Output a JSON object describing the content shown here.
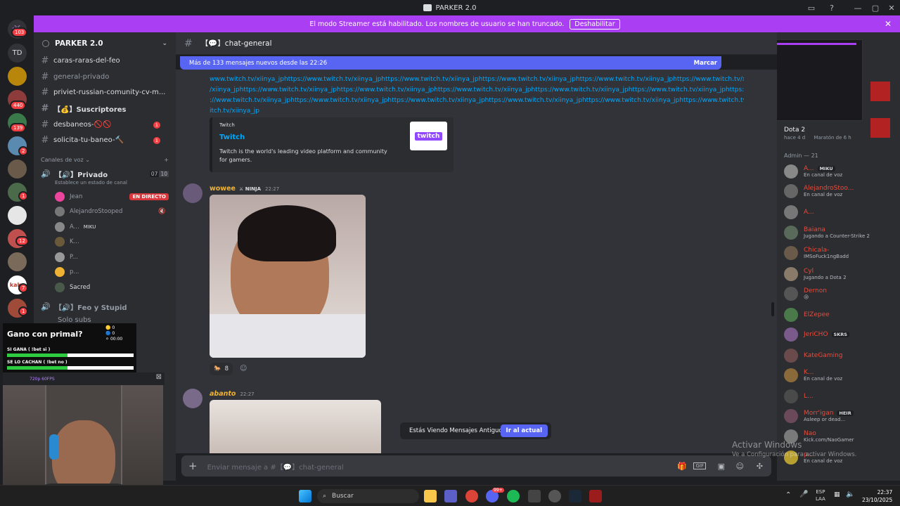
{
  "window": {
    "title": "PARKER 2.0"
  },
  "streamer_banner": {
    "text": "El modo Streamer está habilitado. Los nombres de usuario se han truncado.",
    "button": "Deshabilitar"
  },
  "servers": {
    "top_badge": "103",
    "td_label": "TD",
    "badges": [
      "440",
      "139",
      "2",
      "1",
      "12",
      "7",
      "1"
    ]
  },
  "server": {
    "name": "PARKER 2.0"
  },
  "channels": {
    "text": [
      {
        "name": "caras-raras-del-feo"
      },
      {
        "name": "general-privado"
      },
      {
        "name": "priviet-russian-comunity-cv-m..."
      },
      {
        "name": "【💰】Suscriptores"
      },
      {
        "name": "desbaneos-🚫🚫",
        "badge": "1"
      },
      {
        "name": "solicita-tu-baneo-🔨",
        "badge": "1"
      }
    ],
    "voice_header": "Canales de voz",
    "voice_channel": {
      "name": "【🔊】Privado",
      "count_a": "07",
      "count_b": "10",
      "status": "Establece un estado de canal"
    },
    "voice_users": [
      {
        "name": "Jean",
        "tag": "EN DIRECTO"
      },
      {
        "name": "AlejandroStooped",
        "tag": ""
      },
      {
        "name": "A...",
        "tag": "MIKU"
      },
      {
        "name": "K...",
        "tag": ""
      },
      {
        "name": "P...",
        "tag": ""
      },
      {
        "name": "p...",
        "tag": ""
      },
      {
        "name": "Sacred",
        "tag": ""
      }
    ],
    "voice_channel2": "【🔊】Feo y Stupid",
    "voice_channel3": "Solo subs"
  },
  "overlay": {
    "question": "Gano con primal?",
    "opt1": "SI GANA ( !bet si )",
    "opt2": "SE LO CACHAN ( !bet no )",
    "n1": "0",
    "n2": "0",
    "timer": "00:00",
    "stream_info": "720p 60FPS"
  },
  "chat": {
    "channel_name": "【💬】chat-general",
    "new_messages": "Más de 133 mensajes nuevos desde las 22:26",
    "mark_read": "Marcar",
    "link_lines": [
      "www.twitch.tv/xiinya_jphttps://www.twitch.tv/xiinya_jphttps://www.twitch.tv/xiinya_jphttps://www.twitch.tv/xiinya_jphttps://www.twitch.tv/xiinya_jphttps://www.twitch.tv/xiinya_jphttps://www.twitch.tv/",
      "/xiinya_jphttps://www.twitch.tv/xiinya_jphttps://www.twitch.tv/xiinya_jphttps://www.twitch.tv/xiinya_jphttps://www.twitch.tv/xiinya_jphttps://www.twitch.tv/xiinya_jphttps://www.twitch.tv/xiinya_",
      "://www.twitch.tv/xiinya_jphttps://www.twitch.tv/xiinya_jphttps://www.twitch.tv/xiinya_jphttps://www.twitch.tv/xiinya_jphttps://www.twitch.tv/xiinya_jphttps://www.twitch.tv/xiinya_jphttps://www.twitch.tv/",
      "itch.tv/xiinya_jp"
    ],
    "embed": {
      "provider": "Twitch",
      "title": "Twitch",
      "description": "Twitch is the world's leading video platform and community for gamers."
    },
    "msg1": {
      "author": "wowee",
      "role": "NINJA",
      "time": "22:27",
      "reaction_count": "8"
    },
    "msg2": {
      "author": "abanto",
      "time": "22:27"
    },
    "old_messages": "Estás Viendo Mensajes Antiguos",
    "jump": "Ir al actual",
    "composer_placeholder": "Enviar mensaje a #【💬】chat-general"
  },
  "members": {
    "game": "Dota 2",
    "game_time": "hace 4 d",
    "game_stream": "Maratón de 6 h",
    "section": "Admin — 21",
    "list": [
      {
        "name": "A...",
        "tag": "MIKU",
        "status": "En canal de voz",
        "color": "#e74c3c"
      },
      {
        "name": "AlejandroStoo...",
        "tag": "",
        "status": "En canal de voz",
        "color": "#e74c3c"
      },
      {
        "name": "A...",
        "tag": "",
        "status": "",
        "color": "#e74c3c"
      },
      {
        "name": "Baiana",
        "tag": "",
        "status": "Jugando a Counter-Strike 2",
        "color": "#e74c3c"
      },
      {
        "name": "Chicala-",
        "tag": "",
        "status": "IMSoFuck1ngBadd",
        "color": "#e74c3c"
      },
      {
        "name": "Cyl",
        "tag": "",
        "status": "Jugando a Dota 2",
        "color": "#e74c3c"
      },
      {
        "name": "Dernon",
        "tag": "",
        "status": "😢",
        "color": "#e74c3c"
      },
      {
        "name": "ElZepee",
        "tag": "",
        "status": "",
        "color": "#e74c3c"
      },
      {
        "name": "JeriCHO",
        "tag": "SKRS",
        "status": "",
        "color": "#e74c3c"
      },
      {
        "name": "KateGaming",
        "tag": "",
        "status": "",
        "color": "#e74c3c"
      },
      {
        "name": "K...",
        "tag": "",
        "status": "En canal de voz",
        "color": "#e74c3c"
      },
      {
        "name": "L...",
        "tag": "",
        "status": "",
        "color": "#e74c3c"
      },
      {
        "name": "Morr'igan",
        "tag": "HEIR",
        "status": "Asleep or dead...",
        "color": "#e74c3c"
      },
      {
        "name": "Nao",
        "tag": "",
        "status": "Kick.com/NaoGamer",
        "color": "#e74c3c"
      },
      {
        "name": "p...",
        "tag": "",
        "status": "En canal de voz",
        "color": "#e74c3c"
      }
    ]
  },
  "watermark": {
    "line1": "Activar Windows",
    "line2": "Ve a Configuración para activar Windows."
  },
  "taskbar": {
    "search": "Buscar",
    "lang": "ESP",
    "lang2": "LAA",
    "time": "22:37",
    "date": "23/10/2025",
    "discord_badge": "99+"
  }
}
